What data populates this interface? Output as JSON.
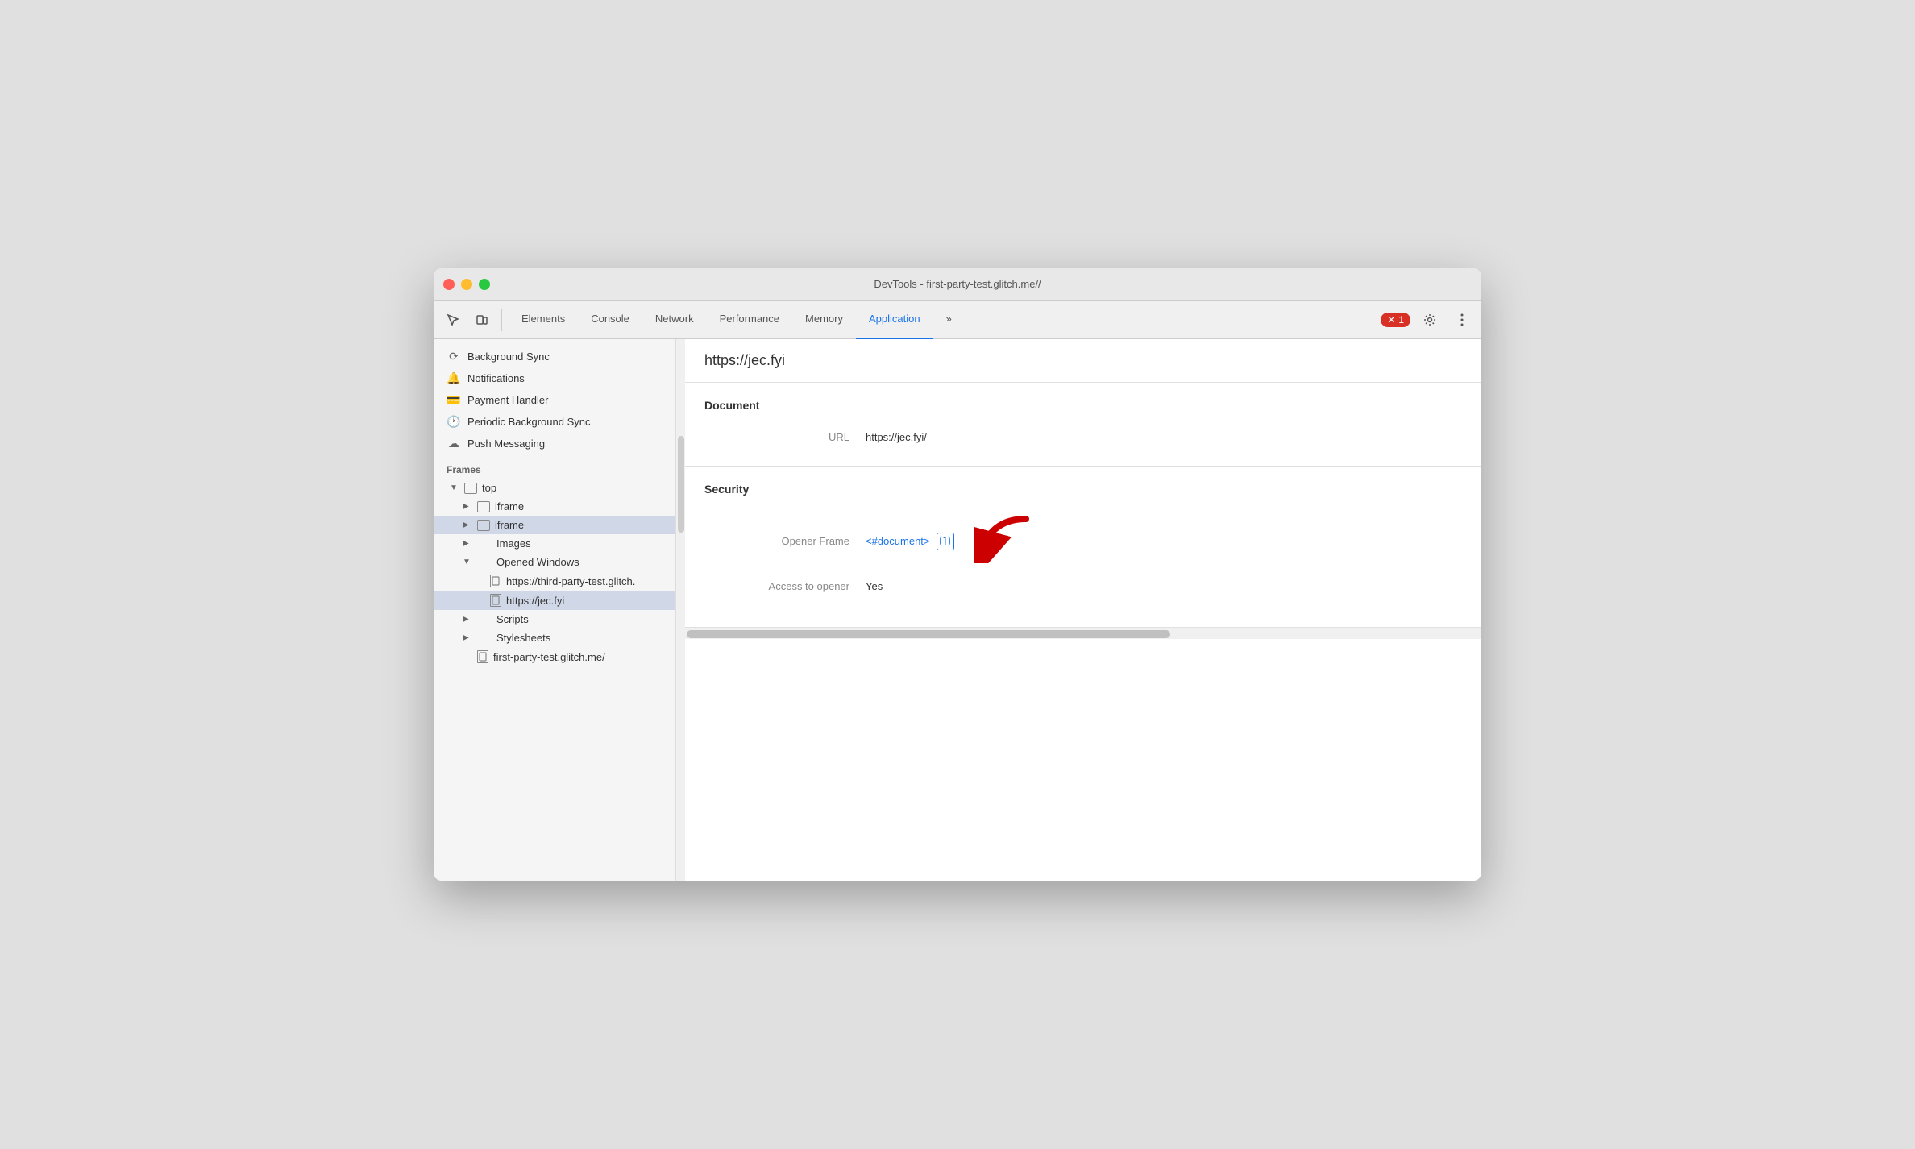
{
  "titlebar": {
    "title": "DevTools - first-party-test.glitch.me//"
  },
  "toolbar": {
    "tabs": [
      {
        "id": "elements",
        "label": "Elements",
        "active": false
      },
      {
        "id": "console",
        "label": "Console",
        "active": false
      },
      {
        "id": "network",
        "label": "Network",
        "active": false
      },
      {
        "id": "performance",
        "label": "Performance",
        "active": false
      },
      {
        "id": "memory",
        "label": "Memory",
        "active": false
      },
      {
        "id": "application",
        "label": "Application",
        "active": true
      }
    ],
    "more_tabs": "»",
    "error_count": "1",
    "settings_title": "Settings",
    "more_title": "More"
  },
  "sidebar": {
    "items_top": [
      {
        "id": "background-sync",
        "icon": "⟳",
        "label": "Background Sync"
      },
      {
        "id": "notifications",
        "icon": "🔔",
        "label": "Notifications"
      },
      {
        "id": "payment-handler",
        "icon": "💳",
        "label": "Payment Handler"
      },
      {
        "id": "periodic-bg-sync",
        "icon": "🕐",
        "label": "Periodic Background Sync"
      },
      {
        "id": "push-messaging",
        "icon": "☁",
        "label": "Push Messaging"
      }
    ],
    "frames_section": "Frames",
    "tree": [
      {
        "id": "top",
        "label": "top",
        "indent": 1,
        "expanded": true,
        "hasArrow": true,
        "icon": "box"
      },
      {
        "id": "iframe1",
        "label": "iframe",
        "indent": 2,
        "expanded": false,
        "hasArrow": true,
        "icon": "box"
      },
      {
        "id": "iframe2",
        "label": "iframe",
        "indent": 2,
        "expanded": false,
        "hasArrow": true,
        "icon": "box",
        "selected": true
      },
      {
        "id": "images",
        "label": "Images",
        "indent": 2,
        "expanded": false,
        "hasArrow": true,
        "icon": "none"
      },
      {
        "id": "opened-windows",
        "label": "Opened Windows",
        "indent": 2,
        "expanded": true,
        "hasArrow": true,
        "icon": "none"
      },
      {
        "id": "ow-child1",
        "label": "https://third-party-test.glitch.me/p",
        "indent": 3,
        "hasArrow": false,
        "icon": "doc"
      },
      {
        "id": "ow-child2",
        "label": "https://jec.fyi",
        "indent": 3,
        "hasArrow": false,
        "icon": "doc",
        "selected": true
      },
      {
        "id": "scripts",
        "label": "Scripts",
        "indent": 2,
        "expanded": false,
        "hasArrow": true,
        "icon": "none"
      },
      {
        "id": "stylesheets",
        "label": "Stylesheets",
        "indent": 2,
        "expanded": false,
        "hasArrow": true,
        "icon": "none"
      },
      {
        "id": "main-doc",
        "label": "first-party-test.glitch.me/",
        "indent": 2,
        "hasArrow": false,
        "icon": "doc"
      }
    ]
  },
  "content": {
    "url": "https://jec.fyi",
    "document_section": "Document",
    "url_label": "URL",
    "url_value": "https://jec.fyi/",
    "security_section": "Security",
    "opener_frame_label": "Opener Frame",
    "opener_frame_link": "<#document>",
    "opener_frame_icon": "⑴",
    "access_to_opener_label": "Access to opener",
    "access_to_opener_value": "Yes"
  }
}
